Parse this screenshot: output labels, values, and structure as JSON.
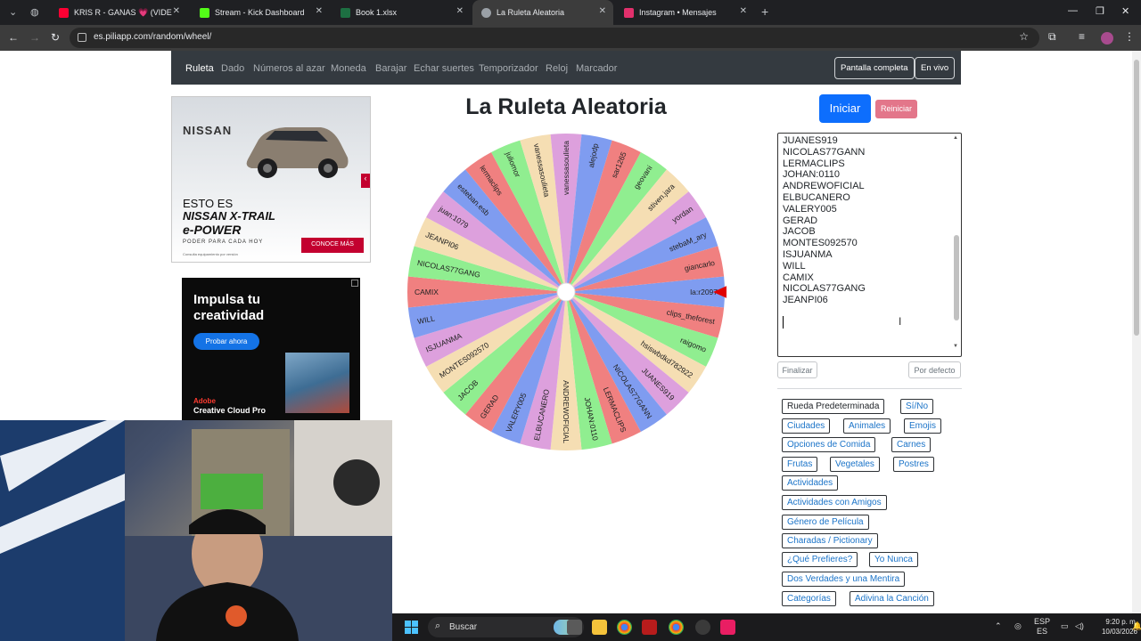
{
  "browser": {
    "tabs": [
      {
        "label": "KRIS R - GANAS 💗 (VIDEO OF",
        "color": "#ff0033"
      },
      {
        "label": "Stream - Kick Dashboard",
        "color": "#53fc18"
      },
      {
        "label": "Book 1.xlsx",
        "color": "#1d6f42"
      },
      {
        "label": "La Ruleta Aleatoria",
        "color": "#9aa0a6"
      },
      {
        "label": "Instagram • Mensajes",
        "color": "#e1306c"
      }
    ],
    "active_tab": 3,
    "url": "es.piliapp.com/random/wheel/"
  },
  "nav": {
    "links": [
      "Ruleta",
      "Dado",
      "Números al azar",
      "Moneda",
      "Barajar",
      "Echar suertes",
      "Temporizador",
      "Reloj",
      "Marcador"
    ],
    "fullscreen": "Pantalla completa",
    "live": "En vivo"
  },
  "ads": {
    "nissan": {
      "brand": "NISSAN",
      "line1": "ESTO ES",
      "line2": "NISSAN X-TRAIL",
      "line3": "e-POWER",
      "line4": "PODER PARA CADA HOY",
      "cta": "CONOCE MÁS",
      "fine": "Consulta equipamiento por versión"
    },
    "adobe": {
      "headline": "Impulsa tu creatividad",
      "button": "Probar ahora",
      "brand": "Adobe",
      "product": "Creative Cloud Pro"
    }
  },
  "wheel": {
    "title": "La Ruleta Aleatoria",
    "colors": [
      "#7f9cf0",
      "#f08080",
      "#90ee90",
      "#f5deb3",
      "#dda0dd"
    ],
    "segments": [
      "la:r2097",
      "clips_theforest",
      "raigomo",
      "hsiswbdkd782922",
      "JUANES919",
      "NICOLAS77GANN",
      "LERMACLIPS",
      "JOHAN:0110",
      "ANDREWOFICIAL",
      "ELBUCANERO",
      "VALERY005",
      "GERAD",
      "JACOB",
      "MONTES092570",
      "ISJUANMA",
      "WILL",
      "CAMIX",
      "NICOLAS77GANG",
      "JEANPI06",
      "juan:1079",
      "esteban.esb",
      "lermaclips",
      "juliomor",
      "vanessasoulieta",
      "vanessasoulieta",
      "alejodp",
      "sar1265",
      "geovani",
      "stiven.jara",
      "yordan",
      "stebaM_ary",
      "giancarlo"
    ]
  },
  "controls": {
    "start": "Iniciar",
    "reset": "Reiniciar",
    "finish": "Finalizar",
    "default": "Por defecto"
  },
  "names_visible": [
    "JUANES919",
    "NICOLAS77GANN",
    "LERMACLIPS",
    "JOHAN:0110",
    "ANDREWOFICIAL",
    "ELBUCANERO",
    "VALERY005",
    "GERAD",
    "JACOB",
    "MONTES092570",
    "ISJUANMA",
    "WILL",
    "CAMIX",
    "NICOLAS77GANG",
    "JEANPI06"
  ],
  "presets": [
    "Rueda Predeterminada",
    "Sí/No",
    "Ciudades",
    "Animales",
    "Emojis",
    "Opciones de Comida",
    "Carnes",
    "Frutas",
    "Vegetales",
    "Postres",
    "Actividades",
    "Actividades con Amigos",
    "Género de Película",
    "Charadas / Pictionary",
    "¿Qué Prefieres?",
    "Yo Nunca",
    "Dos Verdades y una Mentira",
    "Categorías",
    "Adivina la Canción"
  ],
  "taskbar": {
    "search": "Buscar",
    "lang1": "ESP",
    "lang2": "ES",
    "time": "9:20 p. m.",
    "date": "10/03/2026"
  }
}
